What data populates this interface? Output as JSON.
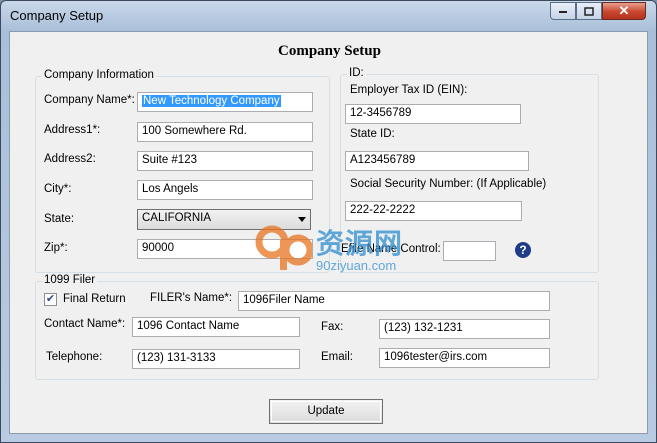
{
  "window": {
    "title": "Company Setup",
    "controls": {
      "minimize": "—",
      "maximize": "□",
      "close": "✕"
    }
  },
  "form": {
    "heading": "Company Setup",
    "company_info": {
      "group_label": "Company Information",
      "company_name_label": "Company Name*:",
      "company_name_value": "New Technology Company",
      "address1_label": "Address1*:",
      "address1_value": "100 Somewhere Rd.",
      "address2_label": "Address2:",
      "address2_value": "Suite #123",
      "city_label": "City*:",
      "city_value": "Los Angels",
      "state_label": "State:",
      "state_value": "CALIFORNIA",
      "zip_label": "Zip*:",
      "zip_value": "90000"
    },
    "id": {
      "group_label": "ID:",
      "ein_label": "Employer Tax ID (EIN):",
      "ein_value": "12-3456789",
      "state_id_label": "State ID:",
      "state_id_value": "A123456789",
      "ssn_label": "Social Security Number: (If Applicable)",
      "ssn_value": "222-22-2222",
      "efile_label": "Efile Name Control:",
      "efile_value": "",
      "help_glyph": "?"
    },
    "filer": {
      "group_label": "1099 Filer",
      "final_return_label": "Final Return",
      "final_return_checked": true,
      "filer_name_label": "FILER's Name*:",
      "filer_name_value": "1096Filer  Name",
      "contact_label": "Contact Name*:",
      "contact_value": "1096 Contact Name",
      "fax_label": "Fax:",
      "fax_value": "(123) 132-1231",
      "telephone_label": "Telephone:",
      "telephone_value": "(123) 131-3133",
      "email_label": "Email:",
      "email_value": "1096tester@irs.com"
    },
    "update_label": "Update"
  },
  "watermark": {
    "big": "资源网",
    "small": "90ziyuan.com",
    "logo_icon": "90-logo-icon"
  },
  "colors": {
    "accent": "#3399ff",
    "help": "#1f3c88",
    "close": "#c8462e"
  }
}
